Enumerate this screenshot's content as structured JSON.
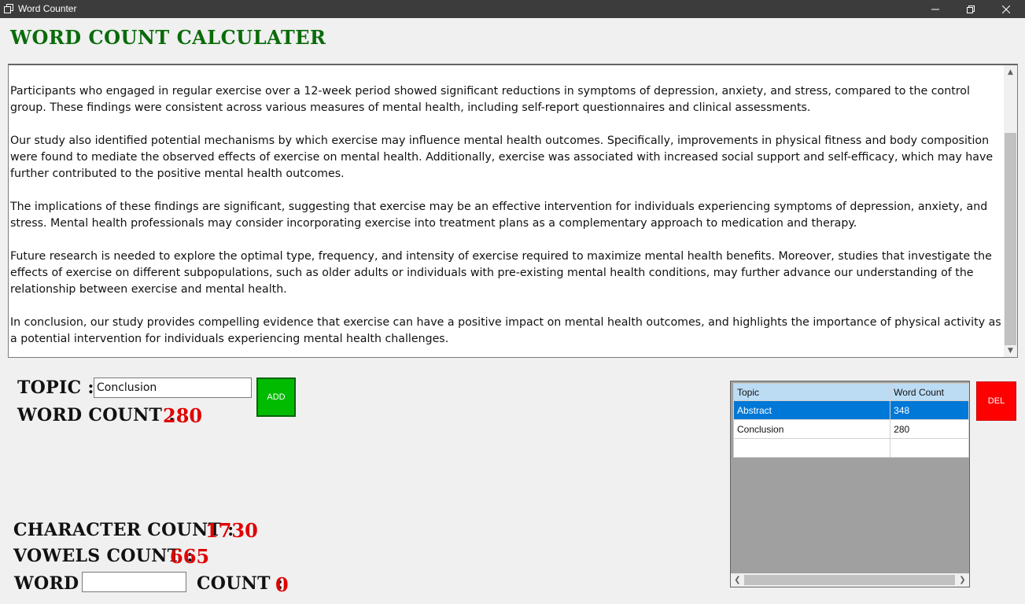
{
  "window": {
    "title": "Word Counter"
  },
  "heading": "Word Count Calculater",
  "text_area": {
    "paragraphs": [
      "Participants who engaged in regular exercise over a 12-week period showed significant reductions in symptoms of depression, anxiety, and stress, compared to the control group. These findings were consistent across various measures of mental health, including self-report questionnaires and clinical assessments.",
      "Our study also identified potential mechanisms by which exercise may influence mental health outcomes. Specifically, improvements in physical fitness and body composition were found to mediate the observed effects of exercise on mental health. Additionally, exercise was associated with increased social support and self-efficacy, which may have further contributed to the positive mental health outcomes.",
      "The implications of these findings are significant, suggesting that exercise may be an effective intervention for individuals experiencing symptoms of depression, anxiety, and stress. Mental health professionals may consider incorporating exercise into treatment plans as a complementary approach to medication and therapy.",
      "Future research is needed to explore the optimal type, frequency, and intensity of exercise required to maximize mental health benefits. Moreover, studies that investigate the effects of exercise on different subpopulations, such as older adults or individuals with pre-existing mental health conditions, may further advance our understanding of the relationship between exercise and mental health.",
      "In conclusion, our study provides compelling evidence that exercise can have a positive impact on mental health outcomes, and highlights the importance of physical activity as a potential intervention for individuals experiencing mental health challenges."
    ]
  },
  "topic": {
    "label": "Topic :",
    "value": "Conclusion"
  },
  "add_button": "ADD",
  "word_count": {
    "label": "Word Count :",
    "value": "280"
  },
  "character_count": {
    "label": "Character Count :",
    "value": "1730"
  },
  "vowels_count": {
    "label": "Vowels Count :",
    "value": "665"
  },
  "word_search": {
    "label": "Word",
    "value": "",
    "count_label": "Count :",
    "count_value": "0"
  },
  "grid": {
    "columns": [
      "Topic",
      "Word Count"
    ],
    "rows": [
      {
        "topic": "Abstract",
        "count": "348",
        "selected": true
      },
      {
        "topic": "Conclusion",
        "count": "280",
        "selected": false
      }
    ]
  },
  "del_button": "DEL",
  "colors": {
    "heading": "#0a6b0a",
    "value_red": "#e00000",
    "add_green": "#00bb00",
    "del_red": "#ff0000",
    "selection": "#0078d7"
  }
}
